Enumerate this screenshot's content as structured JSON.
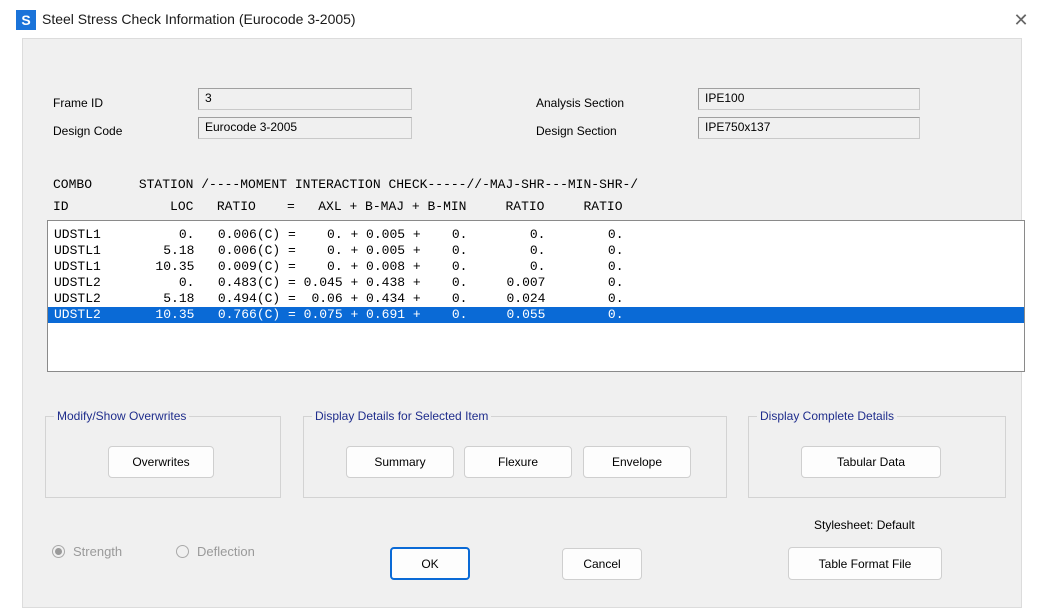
{
  "window": {
    "title": "Steel Stress Check Information (Eurocode 3-2005)",
    "app_icon_letter": "S",
    "close_glyph": "✕"
  },
  "info": {
    "frame_id_label": "Frame ID",
    "frame_id_value": "3",
    "design_code_label": "Design Code",
    "design_code_value": "Eurocode 3-2005",
    "analysis_section_label": "Analysis Section",
    "analysis_section_value": "IPE100",
    "design_section_label": "Design Section",
    "design_section_value": "IPE750x137"
  },
  "table": {
    "header_line1": "COMBO      STATION /----MOMENT INTERACTION CHECK-----//-MAJ-SHR---MIN-SHR-/",
    "header_line2": "ID             LOC   RATIO    =   AXL + B-MAJ + B-MIN     RATIO     RATIO",
    "rows": [
      "UDSTL1          0.   0.006(C) =    0. + 0.005 +    0.        0.        0.",
      "UDSTL1        5.18   0.006(C) =    0. + 0.005 +    0.        0.        0.",
      "UDSTL1       10.35   0.009(C) =    0. + 0.008 +    0.        0.        0.",
      "UDSTL2          0.   0.483(C) = 0.045 + 0.438 +    0.     0.007        0.",
      "UDSTL2        5.18   0.494(C) =  0.06 + 0.434 +    0.     0.024        0.",
      "UDSTL2       10.35   0.766(C) = 0.075 + 0.691 +    0.     0.055        0."
    ],
    "selected_index": 5
  },
  "groups": {
    "modify_title": "Modify/Show Overwrites",
    "display_selected_title": "Display Details for Selected Item",
    "display_complete_title": "Display Complete Details"
  },
  "buttons": {
    "overwrites": "Overwrites",
    "summary": "Summary",
    "flexure": "Flexure",
    "envelope": "Envelope",
    "tabular_data": "Tabular Data",
    "ok": "OK",
    "cancel": "Cancel",
    "table_format_file": "Table Format File"
  },
  "footer": {
    "stylesheet_label": "Stylesheet: Default",
    "radio_strength": "Strength",
    "radio_deflection": "Deflection",
    "strength_selected": true
  },
  "colors": {
    "selection": "#0a6ad6",
    "group_title": "#1f2d8c",
    "panel_bg": "#f0f0f0"
  }
}
